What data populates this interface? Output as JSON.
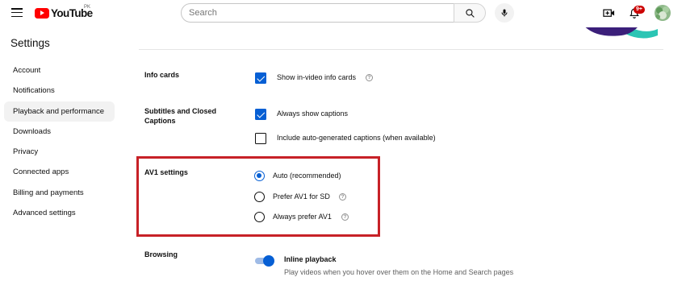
{
  "header": {
    "logo_text": "YouTube",
    "country_code": "PK",
    "search_placeholder": "Search",
    "notification_count": "9+"
  },
  "sidebar": {
    "title": "Settings",
    "items": [
      {
        "label": "Account"
      },
      {
        "label": "Notifications"
      },
      {
        "label": "Playback and performance",
        "active": true
      },
      {
        "label": "Downloads"
      },
      {
        "label": "Privacy"
      },
      {
        "label": "Connected apps"
      },
      {
        "label": "Billing and payments"
      },
      {
        "label": "Advanced settings"
      }
    ]
  },
  "main": {
    "info_cards": {
      "label": "Info cards",
      "option": "Show in-video info cards",
      "checked": true
    },
    "subtitles": {
      "label": "Subtitles and Closed Captions",
      "options": [
        {
          "text": "Always show captions",
          "checked": true
        },
        {
          "text": "Include auto-generated captions (when available)",
          "checked": false
        }
      ]
    },
    "av1": {
      "label": "AV1 settings",
      "options": [
        {
          "text": "Auto (recommended)",
          "selected": true
        },
        {
          "text": "Prefer AV1 for SD",
          "selected": false
        },
        {
          "text": "Always prefer AV1",
          "selected": false
        }
      ]
    },
    "browsing": {
      "label": "Browsing",
      "toggle_title": "Inline playback",
      "toggle_desc": "Play videos when you hover over them on the Home and Search pages",
      "toggle_on": true
    },
    "help_glyph": "?"
  },
  "colors": {
    "accent": "#065fd4",
    "highlight_border": "#c72127",
    "badge": "#cc0000",
    "logo_red": "#ff0000"
  },
  "icons": [
    "menu-icon",
    "youtube-logo-icon",
    "search-icon",
    "mic-icon",
    "create-icon",
    "bell-icon",
    "avatar",
    "help-icon"
  ]
}
